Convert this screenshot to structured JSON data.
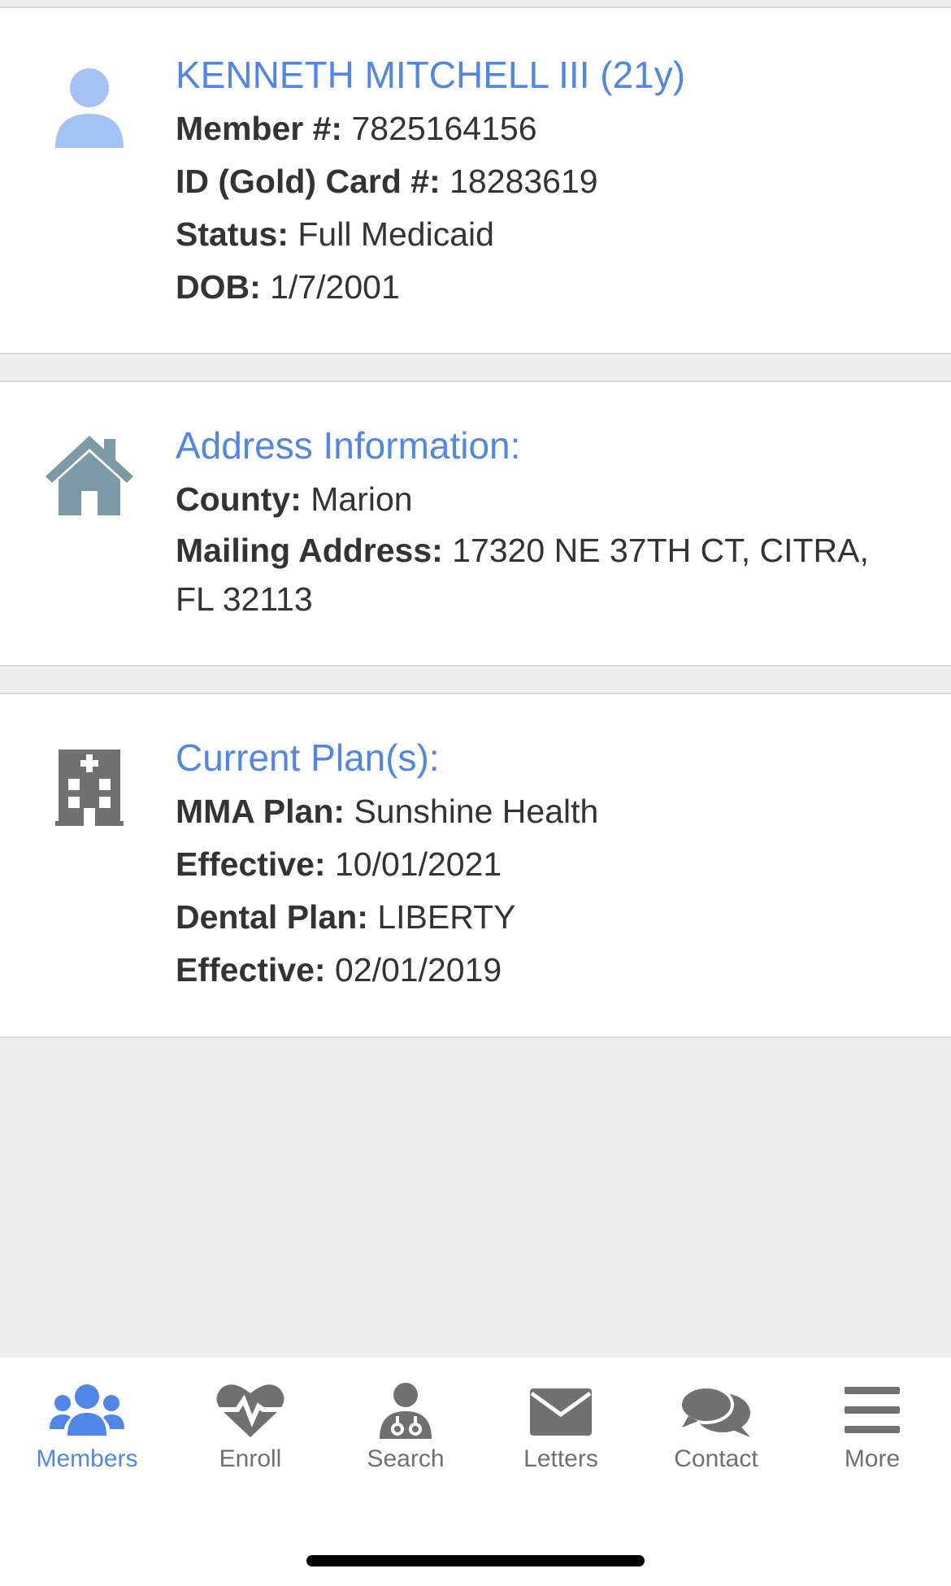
{
  "member": {
    "name": "KENNETH MITCHELL III (21y)",
    "member_label": "Member #:",
    "member_value": "7825164156",
    "card_label": "ID (Gold) Card #:",
    "card_value": "18283619",
    "status_label": "Status:",
    "status_value": "Full Medicaid",
    "dob_label": "DOB:",
    "dob_value": "1/7/2001",
    "icon": "person-icon"
  },
  "address": {
    "title": "Address Information:",
    "county_label": "County:",
    "county_value": "Marion",
    "mailing_label": "Mailing Address:",
    "mailing_value": "17320 NE 37TH CT, CITRA, FL 32113",
    "icon": "house-icon"
  },
  "plans": {
    "title": "Current Plan(s):",
    "mma_label": "MMA Plan:",
    "mma_value": "Sunshine Health",
    "mma_eff_label": "Effective:",
    "mma_eff_value": "10/01/2021",
    "dental_label": "Dental Plan:",
    "dental_value": "LIBERTY",
    "dental_eff_label": "Effective:",
    "dental_eff_value": "02/01/2019",
    "icon": "hospital-icon"
  },
  "tabs": [
    {
      "label": "Members",
      "icon": "users-icon",
      "active": true
    },
    {
      "label": "Enroll",
      "icon": "heartbeat-icon",
      "active": false
    },
    {
      "label": "Search",
      "icon": "doctor-icon",
      "active": false
    },
    {
      "label": "Letters",
      "icon": "envelope-icon",
      "active": false
    },
    {
      "label": "Contact",
      "icon": "chat-icon",
      "active": false
    },
    {
      "label": "More",
      "icon": "menu-icon",
      "active": false
    }
  ],
  "colors": {
    "accent": "#4f86e8",
    "text": "#333333",
    "icon_gray": "#707070",
    "house_icon": "#7b9aa6",
    "background": "#ededed"
  }
}
